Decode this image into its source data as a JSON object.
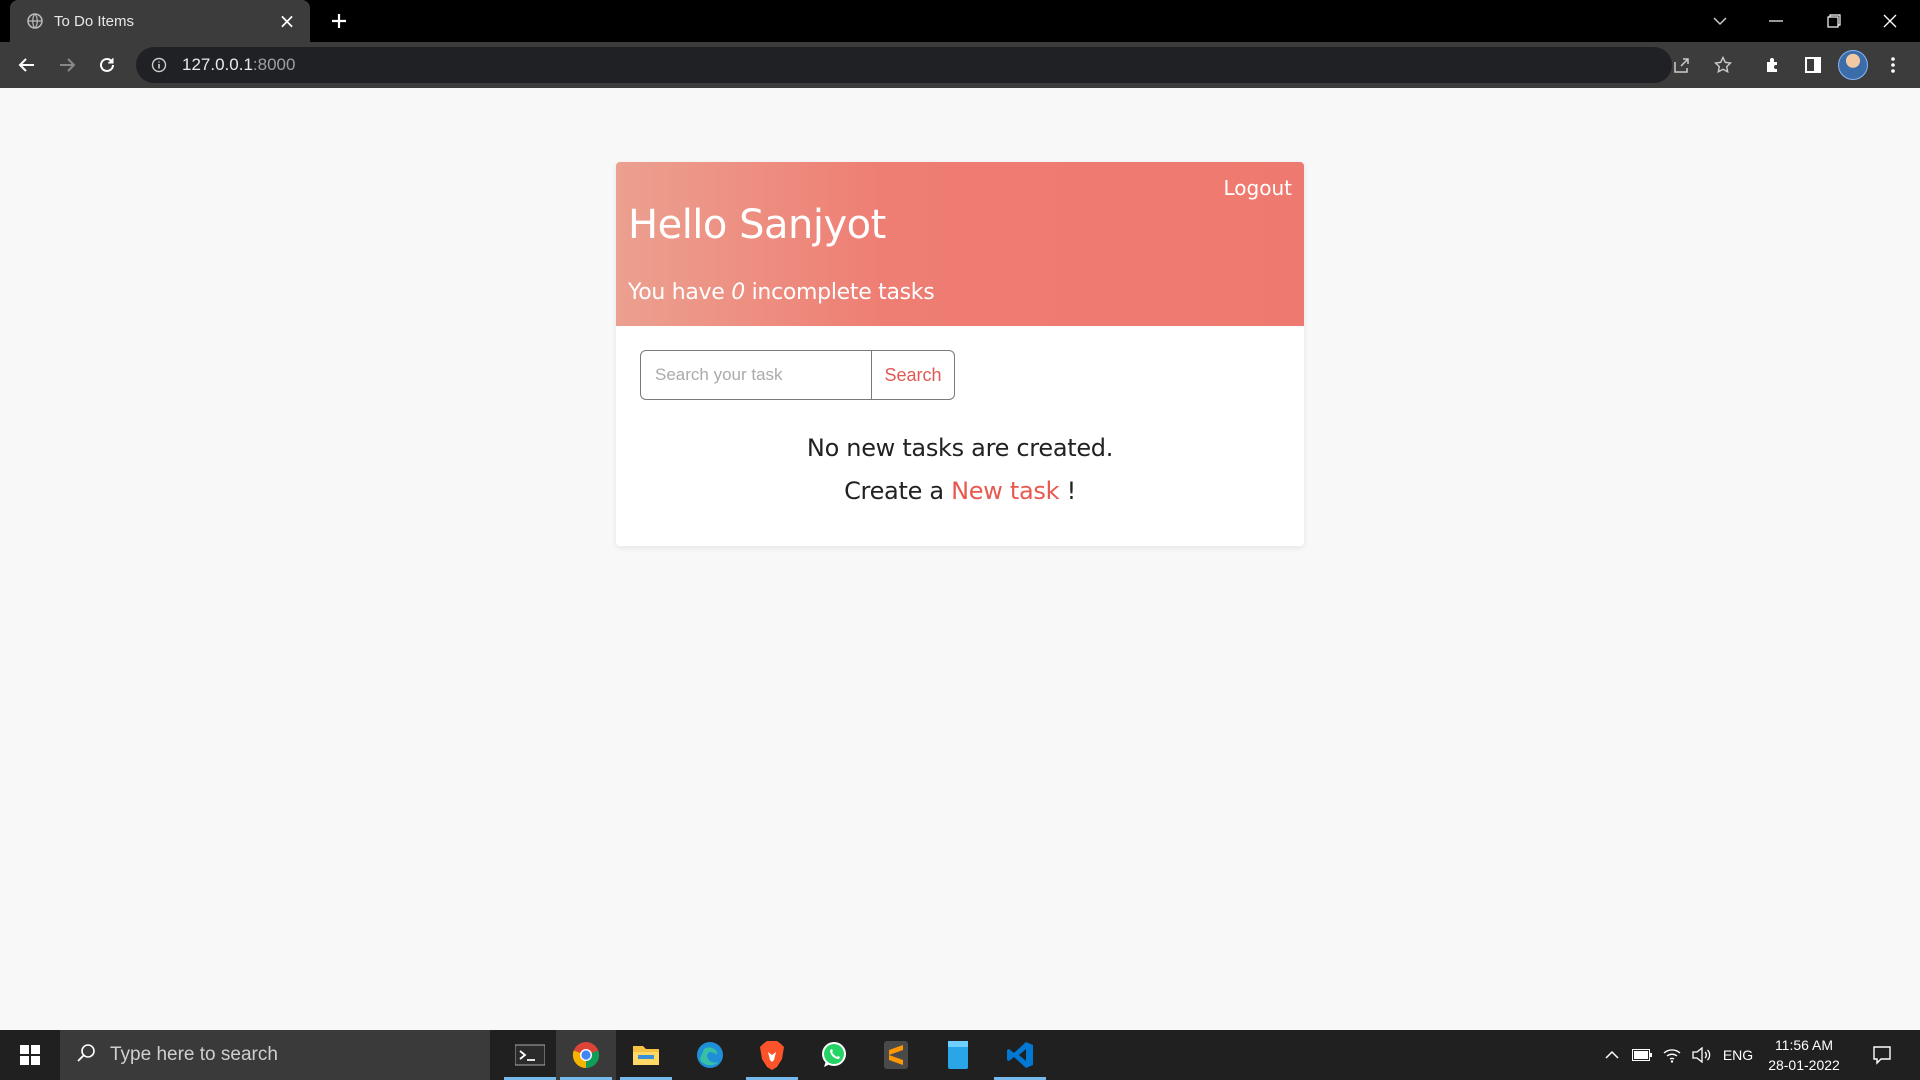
{
  "browser": {
    "tab_title": "To Do Items",
    "url_host": "127.0.0.1",
    "url_port": ":8000"
  },
  "header": {
    "logout_label": "Logout",
    "greeting": "Hello Sanjyot",
    "summary_prefix": "You have",
    "incomplete_count": "0",
    "summary_suffix": "incomplete tasks"
  },
  "search": {
    "placeholder": "Search your task",
    "value": "",
    "button_label": "Search"
  },
  "empty_state": {
    "message": "No new tasks are created.",
    "create_prefix": "Create a",
    "create_link": "New task",
    "create_suffix": "!"
  },
  "taskbar": {
    "search_placeholder": "Type here to search",
    "language": "ENG",
    "time": "11:56 AM",
    "date": "28-01-2022",
    "apps": [
      "terminal",
      "chrome",
      "file-explorer",
      "edge",
      "brave",
      "whatsapp",
      "sublime-text",
      "notepad",
      "vscode"
    ]
  },
  "colors": {
    "header_gradient_start": "#eca08f",
    "header_gradient_end": "#ee7970",
    "accent": "#e8584f",
    "page_background": "#f8f8f8"
  }
}
